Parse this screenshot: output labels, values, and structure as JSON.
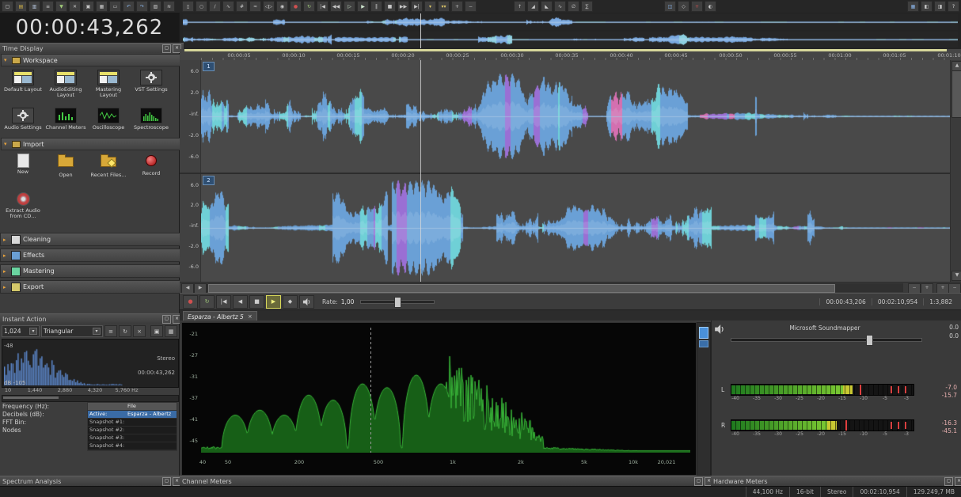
{
  "time_display": {
    "title": "Time Display",
    "value": "00:00:43,262"
  },
  "toolbar": {
    "groups": [
      {
        "name": "file-edit",
        "icons": [
          "new-file",
          "open-file",
          "save",
          "properties",
          "import-file",
          "cut",
          "copy",
          "paste",
          "trim",
          "undo",
          "redo",
          "mix-paste",
          "preferences"
        ]
      },
      {
        "name": "tools-transport",
        "icons": [
          "selection-tool",
          "magnify",
          "pencil-tool",
          "envelope-tool",
          "snap-toggle",
          "auto-ripple",
          "crossfade",
          "lock",
          "record",
          "loop-playback",
          "go-to-start",
          "rewind",
          "play-all",
          "play",
          "pause",
          "stop",
          "forward",
          "go-to-end",
          "marker-insert",
          "region-insert",
          "zoom-in",
          "zoom-out"
        ]
      },
      {
        "name": "process",
        "icons": [
          "normalize",
          "fade-in",
          "fade-out",
          "invert",
          "mute-segment",
          "statistics"
        ]
      },
      {
        "name": "effects",
        "icons": [
          "plugin-chain",
          "effect-automation",
          "repair",
          "analyze"
        ]
      },
      {
        "name": "window",
        "icons": [
          "workspace-layout",
          "dock-windows",
          "float-windows",
          "help"
        ]
      }
    ]
  },
  "left_panel": {
    "instant_action_title": "Instant Action",
    "workspace_label": "Workspace",
    "import_label": "Import",
    "workspace_items": [
      {
        "name": "default-layout",
        "label": "Default Layout",
        "type": "layout"
      },
      {
        "name": "audioediting-layout",
        "label": "AudioEditing Layout",
        "type": "layout"
      },
      {
        "name": "mastering-layout",
        "label": "Mastering Layout",
        "type": "layout"
      },
      {
        "name": "vst-settings",
        "label": "VST Settings",
        "type": "gear"
      },
      {
        "name": "audio-settings",
        "label": "Audio Settings",
        "type": "gear"
      },
      {
        "name": "channel-meters",
        "label": "Channel Meters",
        "type": "meters"
      },
      {
        "name": "oscilloscope",
        "label": "Oscilloscope",
        "type": "scope"
      },
      {
        "name": "spectroscope",
        "label": "Spectroscope",
        "type": "spectro"
      }
    ],
    "import_items": [
      {
        "name": "new",
        "label": "New",
        "type": "page"
      },
      {
        "name": "open",
        "label": "Open",
        "type": "folder"
      },
      {
        "name": "recent-files",
        "label": "Recent Files...",
        "type": "folder-recent"
      },
      {
        "name": "record",
        "label": "Record",
        "type": "record"
      },
      {
        "name": "extract-audio-cd",
        "label": "Extract Audio from CD...",
        "type": "cd"
      }
    ],
    "collapsed_sections": [
      {
        "name": "cleaning",
        "label": "Cleaning"
      },
      {
        "name": "effects",
        "label": "Effects"
      },
      {
        "name": "mastering",
        "label": "Mastering"
      },
      {
        "name": "export",
        "label": "Export"
      }
    ]
  },
  "editor": {
    "ruler_labels": [
      "00:00:05",
      "00:00:10",
      "00:00:15",
      "00:00:20",
      "00:00:25",
      "00:00:30",
      "00:00:35",
      "00:00:40",
      "00:00:45",
      "00:00:50",
      "00:00:55",
      "00:01:00",
      "00:01:05",
      "00:01:10"
    ],
    "db_labels": [
      "6.0",
      "2.0",
      "-inf.",
      "-2.0",
      "-6.0"
    ],
    "channel_badges": [
      "1",
      "2"
    ],
    "tab_label": "Esparza - Albertz 5",
    "transport": {
      "rate_label": "Rate:",
      "rate_value": "1,00",
      "position": "00:00:43,206",
      "length": "00:02:10,954",
      "ratio": "1:3,882"
    }
  },
  "spectrum_analysis": {
    "title": "Spectrum Analysis",
    "fft_size": "1,024",
    "window_type": "Triangular",
    "display": {
      "stereo_label": "Stereo",
      "cursor_time": "00:00:43,262",
      "db_top": "-48",
      "db_bottom": "dB -105",
      "freq_labels": [
        "10",
        "1,440",
        "2,880",
        "4,320",
        "5,760 Hz"
      ]
    },
    "info_labels": [
      "Frequency (Hz):",
      "Decibels (dB):",
      "FFT Bin:",
      "Nodes"
    ],
    "table": {
      "header": "File",
      "rows": [
        {
          "label": "Active:",
          "value": "Esparza - Albertz",
          "active": true
        },
        {
          "label": "Snapshot #1:",
          "value": ""
        },
        {
          "label": "Snapshot #2:",
          "value": ""
        },
        {
          "label": "Snapshot #3:",
          "value": ""
        },
        {
          "label": "Snapshot #4:",
          "value": ""
        }
      ]
    }
  },
  "channel_meters": {
    "title": "Channel Meters",
    "y_labels": [
      "-21",
      "-27",
      "-31",
      "-37",
      "-41",
      "-45"
    ],
    "x_labels": [
      "40",
      "50",
      "200",
      "500",
      "1k",
      "2k",
      "5k",
      "10k",
      "20,021"
    ]
  },
  "hardware_meters": {
    "title": "Hardware Meters",
    "device": "Microsoft Soundmapper",
    "gain_db": [
      "0.0",
      "0.0"
    ],
    "scale_labels": [
      "-40",
      "-35",
      "-30",
      "-25",
      "-20",
      "-15",
      "-10",
      "-5",
      "-3"
    ],
    "channels": [
      {
        "label": "L",
        "readouts": [
          "-7.0",
          "-15.7"
        ],
        "level": 0.62,
        "peak": 0.71
      },
      {
        "label": "R",
        "readouts": [
          "-16.3",
          "-45.1"
        ],
        "level": 0.53,
        "peak": 0.63
      }
    ]
  },
  "status_bar": {
    "items": [
      "44,100 Hz",
      "16-bit",
      "Stereo",
      "00:02:10,954",
      "129.249,7 MB"
    ]
  }
}
